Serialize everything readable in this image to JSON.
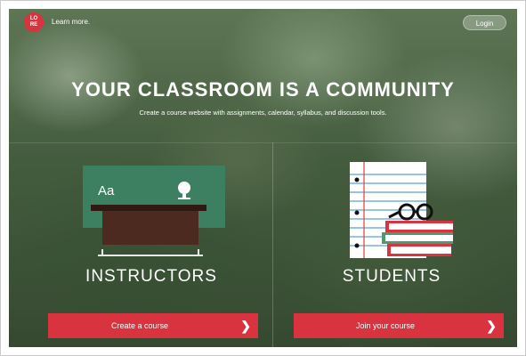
{
  "header": {
    "logo_text": "LORE",
    "learn_more": "Learn more.",
    "login": "Login"
  },
  "hero": {
    "title": "YOUR CLASSROOM IS A COMMUNITY",
    "subtitle": "Create a course website with assignments, calendar, syllabus, and discussion tools."
  },
  "instructors": {
    "heading": "INSTRUCTORS",
    "board_text": "Aa",
    "button_label": "Create a course",
    "button_icon": "chevron-right-icon"
  },
  "students": {
    "heading": "STUDENTS",
    "button_label": "Join your course",
    "button_icon": "chevron-right-icon"
  },
  "colors": {
    "brand_red": "#d8333e",
    "chalkboard": "#3d8061",
    "desk": "#4d2a20"
  }
}
